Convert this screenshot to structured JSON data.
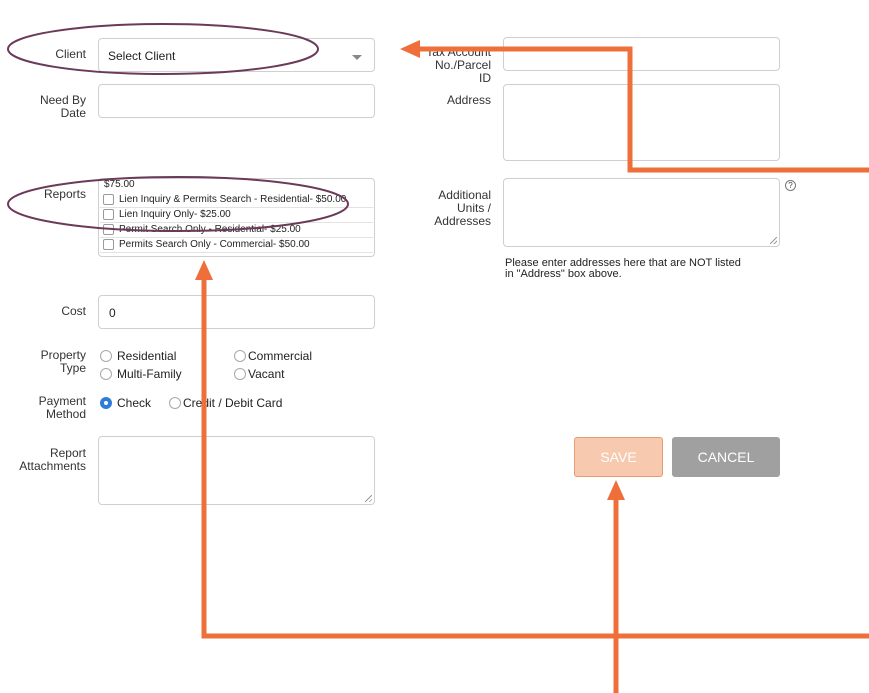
{
  "form": {
    "client": {
      "label": "Client",
      "value": "Select Client"
    },
    "need_by": {
      "label_line1": "Need By",
      "label_line2": "Date",
      "value": ""
    },
    "tax_account": {
      "label_line1": "Tax Account",
      "label_line2": "No./Parcel",
      "label_line3": "ID",
      "value": ""
    },
    "address": {
      "label": "Address",
      "value": ""
    },
    "additional_units": {
      "label_line1": "Additional",
      "label_line2": "Units /",
      "label_line3": "Addresses",
      "help": "?",
      "hint_line1": "Please enter addresses here that are NOT listed",
      "hint_line2": "in \"Address\" box above."
    },
    "reports": {
      "label": "Reports",
      "price_header": "$75.00",
      "items": [
        "Lien Inquiry & Permits Search - Residential- $50.00",
        "Lien Inquiry Only- $25.00",
        "Permit Search Only - Residential- $25.00",
        "Permits Search Only - Commercial- $50.00"
      ]
    },
    "cost": {
      "label": "Cost",
      "value": "0"
    },
    "property_type": {
      "label_line1": "Property",
      "label_line2": "Type",
      "options": [
        "Residential",
        "Commercial",
        "Multi-Family",
        "Vacant"
      ]
    },
    "payment_method": {
      "label_line1": "Payment",
      "label_line2": "Method",
      "options": [
        "Check",
        "Credit / Debit Card"
      ],
      "selected": "Check"
    },
    "attachments": {
      "label_line1": "Report",
      "label_line2": "Attachments"
    },
    "save_label": "SAVE",
    "cancel_label": "CANCEL"
  },
  "colors": {
    "annotation_arrow": "#ee6f3a",
    "annotation_ellipse": "#6b3a5a",
    "save_bg": "#f7c9ae",
    "save_border": "#e89a70",
    "cancel_bg": "#a0a0a0",
    "radio_selected": "#2f7cd6"
  }
}
